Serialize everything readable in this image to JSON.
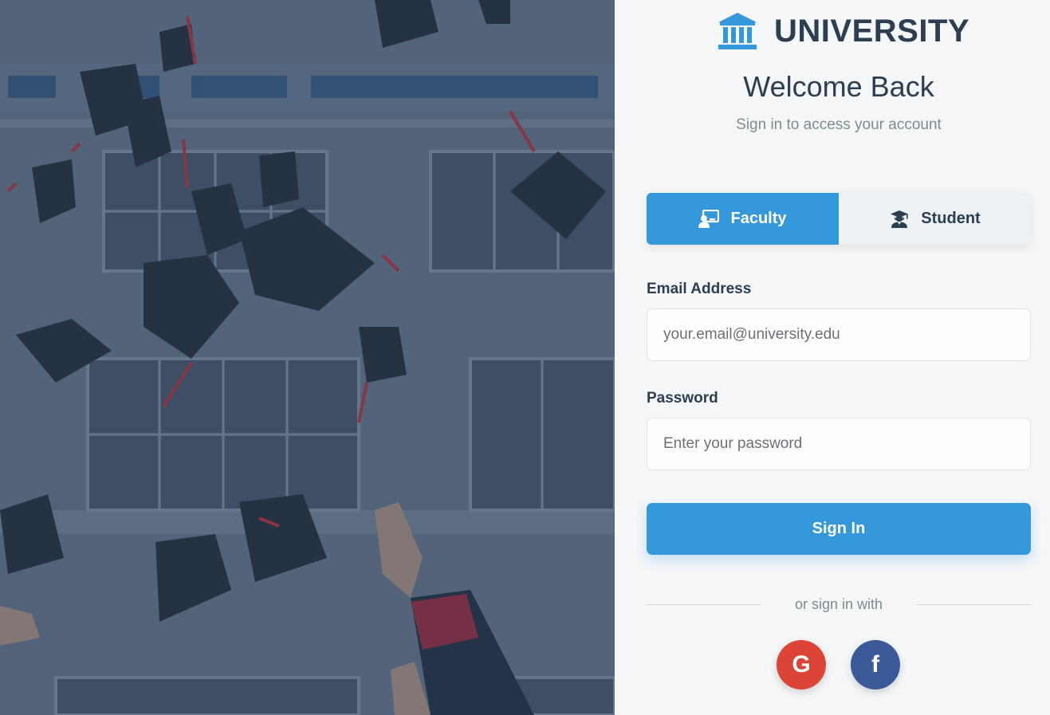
{
  "brand": {
    "name": "UNIVERSITY",
    "icon": "university-building-icon",
    "accent_color": "#3498db"
  },
  "welcome": {
    "title": "Welcome Back",
    "subtitle": "Sign in to access your account"
  },
  "role_tabs": [
    {
      "label": "Faculty",
      "icon": "chalkboard-teacher-icon",
      "active": true
    },
    {
      "label": "Student",
      "icon": "user-graduate-icon",
      "active": false
    }
  ],
  "form": {
    "email_label": "Email Address",
    "email_placeholder": "your.email@university.edu",
    "email_value": "",
    "password_label": "Password",
    "password_placeholder": "Enter your password",
    "password_value": "",
    "submit_label": "Sign In"
  },
  "social": {
    "divider_text": "or sign in with",
    "providers": [
      {
        "name": "Google",
        "glyph": "G",
        "icon": "google-icon",
        "color": "#db4437"
      },
      {
        "name": "Facebook",
        "glyph": "f",
        "icon": "facebook-icon",
        "color": "#3b5998"
      }
    ]
  },
  "colors": {
    "primary": "#3498db",
    "heading": "#2c3e50",
    "muted": "#7f8c8d",
    "panel_bg": "#f4f6f8"
  }
}
